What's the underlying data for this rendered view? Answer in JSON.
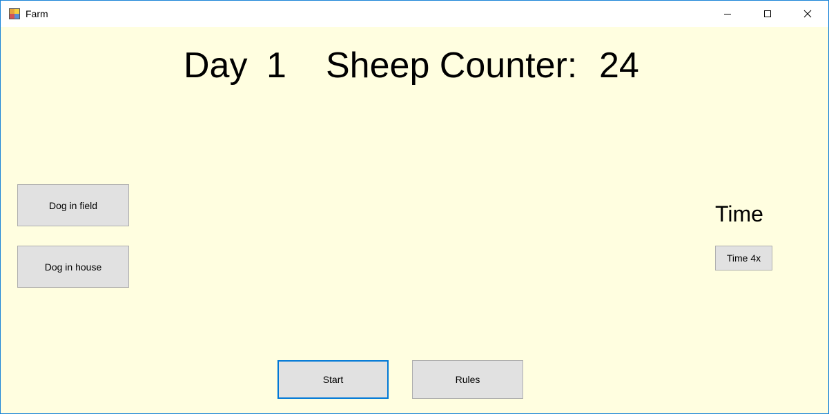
{
  "window": {
    "title": "Farm"
  },
  "titlebar": {
    "icon": "app-icon",
    "controls": [
      "minimize-icon",
      "maximize-icon",
      "close-icon"
    ]
  },
  "header": {
    "day_label": "Day",
    "day_value": "1",
    "sheep_label": "Sheep Counter:",
    "sheep_value": "24"
  },
  "left_panel": {
    "dog_field_label": "Dog in field",
    "dog_house_label": "Dog in house"
  },
  "right_panel": {
    "time_label": "Time",
    "time_button_label": "Time 4x"
  },
  "bottom": {
    "start_label": "Start",
    "rules_label": "Rules"
  },
  "colors": {
    "form_background": "#fffee0",
    "button_background": "#e1e1e1",
    "focus_border": "#0078d7"
  }
}
